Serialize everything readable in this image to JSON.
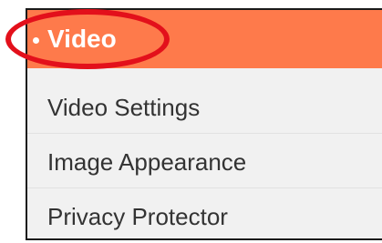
{
  "menu": {
    "header": {
      "label": "Video",
      "background_color": "#fe7a4b",
      "highlight_ring_color": "#e3101b"
    },
    "items": [
      {
        "label": "Video Settings"
      },
      {
        "label": "Image Appearance"
      },
      {
        "label": "Privacy Protector"
      }
    ]
  }
}
